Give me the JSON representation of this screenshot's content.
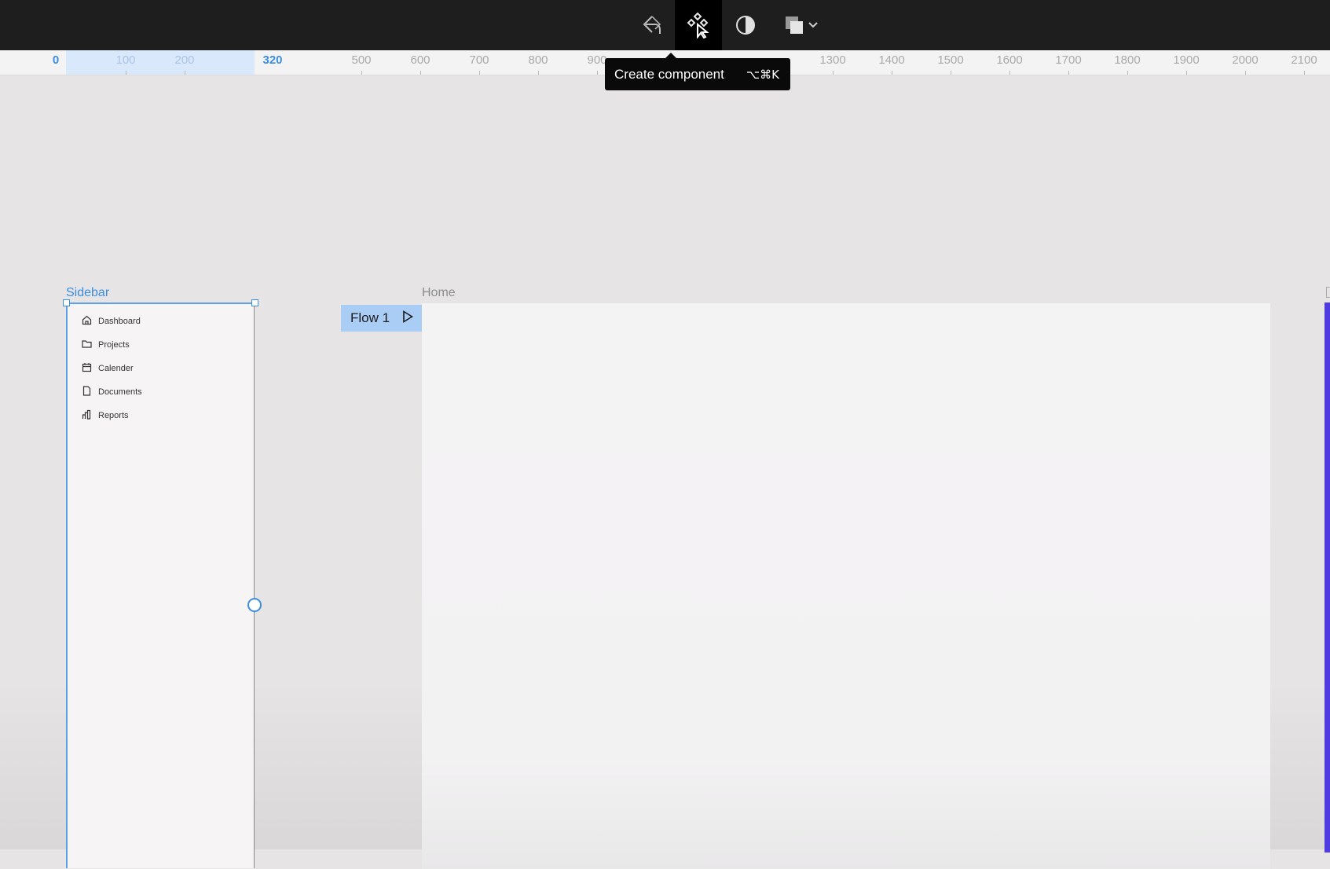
{
  "toolbar": {
    "tools": [
      {
        "icon": "navigate-back-icon",
        "active": false
      },
      {
        "icon": "create-component-icon",
        "active": true
      },
      {
        "icon": "contrast-icon",
        "active": false
      },
      {
        "icon": "layers-stack-icon",
        "active": false
      }
    ],
    "tooltip": {
      "label": "Create component",
      "shortcut": "⌥⌘K"
    }
  },
  "ruler": {
    "selection_start": "0",
    "selection_end": "320",
    "faint_labels": [
      "100",
      "200"
    ],
    "labels": [
      "500",
      "600",
      "700",
      "800",
      "900",
      "1300",
      "1400",
      "1500",
      "1600",
      "1700",
      "1800",
      "1900",
      "2000",
      "2100"
    ]
  },
  "canvas": {
    "sidebar_frame": {
      "label": "Sidebar",
      "items": [
        {
          "label": "Dashboard",
          "icon": "home-icon"
        },
        {
          "label": "Projects",
          "icon": "folder-icon"
        },
        {
          "label": "Calender",
          "icon": "calendar-icon"
        },
        {
          "label": "Documents",
          "icon": "document-icon"
        },
        {
          "label": "Reports",
          "icon": "bar-chart-icon"
        }
      ]
    },
    "flow_tag": {
      "label": "Flow 1",
      "icon": "play-icon"
    },
    "home_frame": {
      "label": "Home"
    }
  },
  "colors": {
    "selection": "#3b8de0",
    "toolbar_bg": "#1e1e1e",
    "flow_tag_bg": "#a9cdf5",
    "edge_accent": "#4e3ce0"
  }
}
